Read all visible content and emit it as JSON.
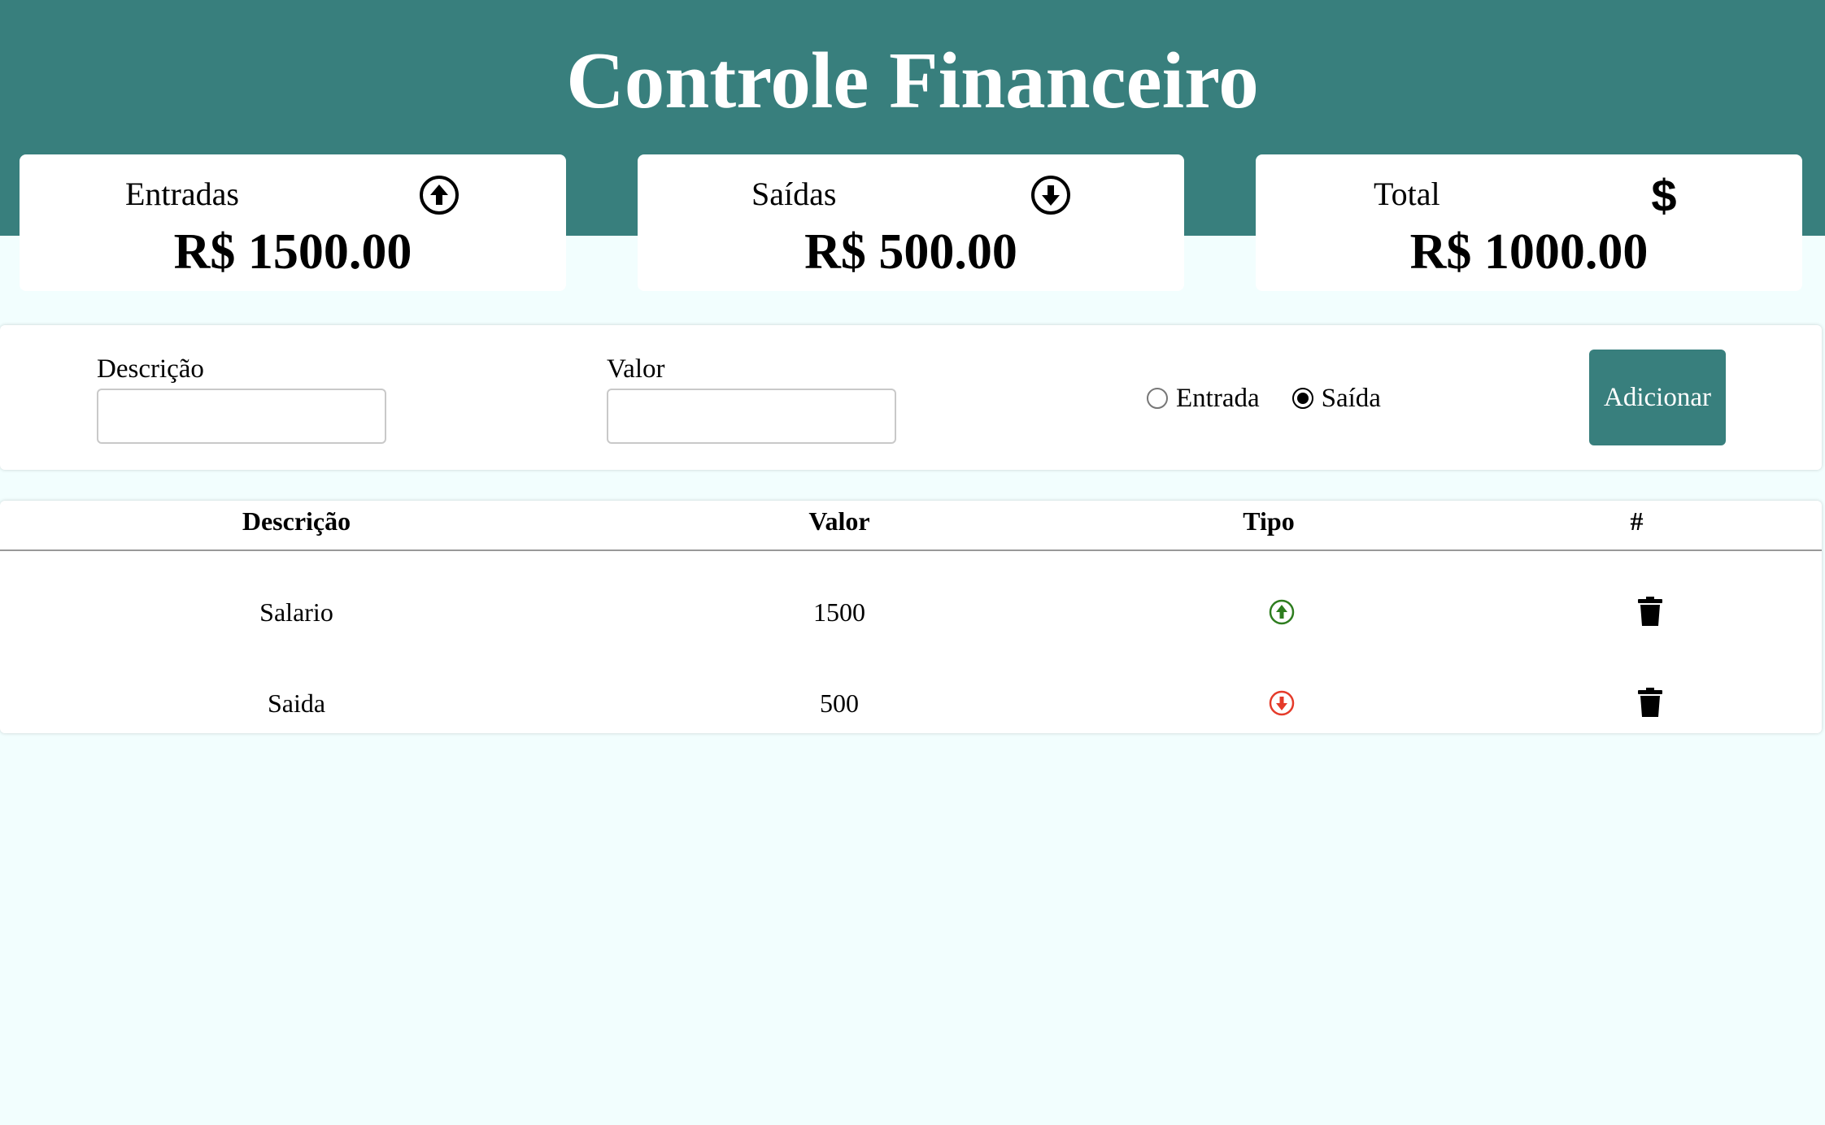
{
  "header": {
    "title": "Controle Financeiro",
    "background_color": "#387f7d"
  },
  "cards": {
    "entradas": {
      "label": "Entradas",
      "value": "R$ 1500.00",
      "icon": "arrow-circle-up-icon"
    },
    "saidas": {
      "label": "Saídas",
      "value": "R$ 500.00",
      "icon": "arrow-circle-down-icon"
    },
    "total": {
      "label": "Total",
      "value": "R$ 1000.00",
      "icon": "dollar-sign-icon"
    }
  },
  "form": {
    "descricao_label": "Descrição",
    "descricao_value": "",
    "valor_label": "Valor",
    "valor_value": "",
    "radio_entrada_label": "Entrada",
    "radio_saida_label": "Saída",
    "selected_type": "Saída",
    "add_button_label": "Adicionar"
  },
  "table": {
    "headers": [
      "Descrição",
      "Valor",
      "Tipo",
      "#"
    ],
    "rows": [
      {
        "descricao": "Salario",
        "valor": "1500",
        "tipo": "entrada",
        "tipo_icon": "arrow-circle-up-icon",
        "tipo_color": "#2e7d1f",
        "action_icon": "trash-icon"
      },
      {
        "descricao": "Saida",
        "valor": "500",
        "tipo": "saida",
        "tipo_icon": "arrow-circle-down-icon",
        "tipo_color": "#e53b2a",
        "action_icon": "trash-icon"
      }
    ]
  },
  "colors": {
    "accent": "#387f7d",
    "page_background": "#f2fefe",
    "entrada": "#2e7d1f",
    "saida": "#e53b2a"
  }
}
